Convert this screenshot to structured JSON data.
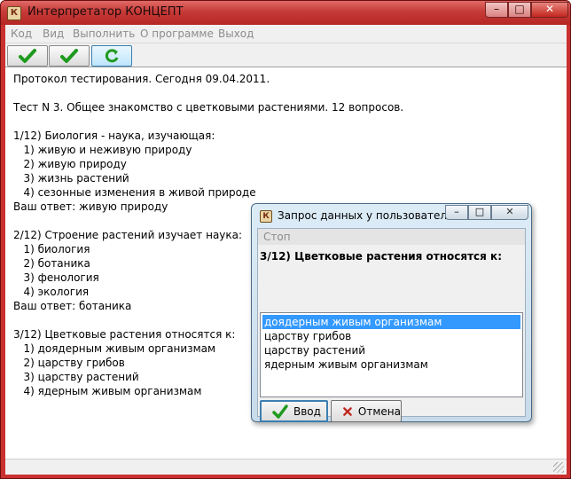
{
  "window": {
    "title": "Интерпретатор КОНЦЕПТ",
    "min_symbol": "–",
    "max_symbol": "□",
    "close_symbol": "✕"
  },
  "menu": [
    "Код",
    "Вид",
    "Выполнить",
    "О программе",
    "Выход"
  ],
  "toolbar": {
    "buttons": [
      {
        "icon": "checkmark-icon"
      },
      {
        "icon": "checkmark-icon"
      },
      {
        "icon": "refresh-icon"
      }
    ]
  },
  "protocol": {
    "lines": [
      "Протокол тестирования. Сегодня 09.04.2011.",
      "",
      "Тест N 3. Общее знакомство с цветковыми растениями. 12 вопросов.",
      "",
      "1/12) Биология - наука, изучающая:",
      "   1) живую и неживую природу",
      "   2) живую природу",
      "   3) жизнь растений",
      "   4) сезонные изменения в живой природе",
      "Ваш ответ: живую природу",
      "",
      "2/12) Строение растений изучает наука:",
      "   1) биология",
      "   2) ботаника",
      "   3) фенология",
      "   4) экология",
      "Ваш ответ: ботаника",
      "",
      "3/12) Цветковые растения относятся к:",
      "   1) доядерным живым организмам",
      "   2) царству грибов",
      "   3) царству растений",
      "   4) ядерным живым организмам"
    ]
  },
  "dialog": {
    "title": "Запрос данных у пользователя",
    "menu_label": "Стоп",
    "question": "3/12) Цветковые растения относятся к:",
    "options": [
      "доядерным живым организмам",
      "царству грибов",
      "царству растений",
      "ядерным живым организмам"
    ],
    "selected_index": 0,
    "ok_label": "Ввод",
    "cancel_label": "Отмена"
  },
  "colors": {
    "titlebar": "#c63a37",
    "selection": "#3399ff",
    "check_green": "#1e9a1e",
    "cancel_red": "#c0231c"
  }
}
